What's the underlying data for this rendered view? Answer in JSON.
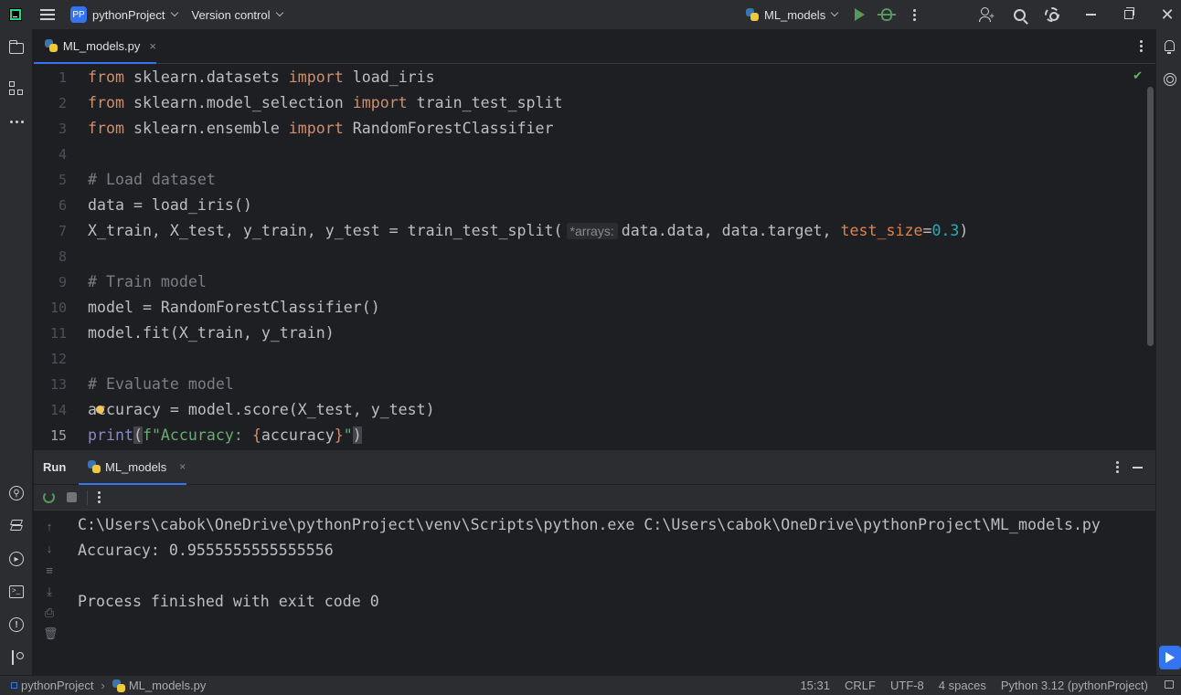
{
  "titlebar": {
    "project_badge": "PP",
    "project_name": "pythonProject",
    "version_control": "Version control",
    "run_config": "ML_models"
  },
  "editor": {
    "tab_label": "ML_models.py",
    "tab_close": "×",
    "line_numbers": [
      "1",
      "2",
      "3",
      "4",
      "5",
      "6",
      "7",
      "8",
      "9",
      "10",
      "11",
      "12",
      "13",
      "14",
      "15"
    ],
    "current_line": "15",
    "lines": {
      "l1": {
        "kw1": "from",
        "mod": " sklearn.datasets ",
        "kw2": "import",
        "name": " load_iris"
      },
      "l2": {
        "kw1": "from",
        "mod": " sklearn.model_selection ",
        "kw2": "import",
        "name": " train_test_split"
      },
      "l3": {
        "kw1": "from",
        "mod": " sklearn.ensemble ",
        "kw2": "import",
        "name": " RandomForestClassifier"
      },
      "l5": "# Load dataset",
      "l6": "data = load_iris()",
      "l7": {
        "prefix": "X_train, X_test, y_train, y_test = train_test_split(",
        "hint": "*arrays:",
        "args": "data.data, data.target, ",
        "param": "test_size",
        "eq": "=",
        "num": "0.3",
        "close": ")"
      },
      "l9": "# Train model",
      "l10": "model = RandomForestClassifier()",
      "l11": "model.fit(X_train, y_train)",
      "l13": "# Evaluate model",
      "l14": "accuracy = model.score(X_test, y_test)",
      "l15": {
        "fn": "print",
        "open": "(",
        "fstr1": "f\"Accuracy: ",
        "brace_open": "{",
        "var": "accuracy",
        "brace_close": "}",
        "fstr2": "\"",
        "close": ")"
      }
    }
  },
  "run_panel": {
    "title": "Run",
    "tab_label": "ML_models",
    "tab_close": "×",
    "output": [
      "C:\\Users\\cabok\\OneDrive\\pythonProject\\venv\\Scripts\\python.exe C:\\Users\\cabok\\OneDrive\\pythonProject\\ML_models.py",
      "Accuracy: 0.9555555555555556",
      "",
      "Process finished with exit code 0"
    ]
  },
  "statusbar": {
    "breadcrumb_project": "pythonProject",
    "breadcrumb_file": "ML_models.py",
    "position": "15:31",
    "line_ending": "CRLF",
    "encoding": "UTF-8",
    "indent": "4 spaces",
    "interpreter": "Python 3.12 (pythonProject)"
  },
  "icons": {
    "accent": "#3574f0",
    "run_green": "#57965c"
  }
}
